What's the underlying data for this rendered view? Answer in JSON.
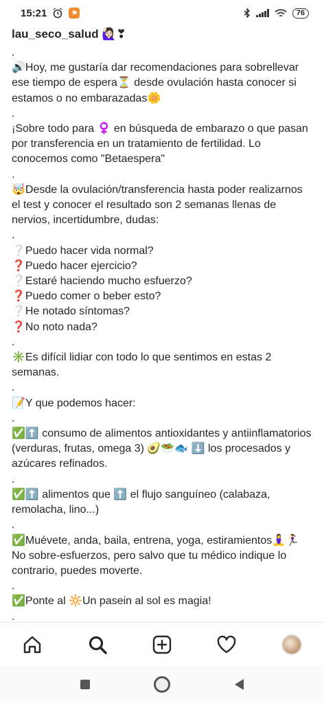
{
  "status_bar": {
    "time": "15:21",
    "battery": "76"
  },
  "post": {
    "username": "lau_seco_salud 🙋🏻‍♀️❣",
    "caption_blocks": [
      ".",
      "🔊Hoy, me gustaría dar recomendaciones para sobrellevar ese tiempo de espera⏳ desde ovulación hasta conocer si estamos o no embarazadas🌼",
      ".",
      "¡Sobre todo para ♀️ en búsqueda de embarazo o que pasan por transferencia en un tratamiento de fertilidad. Lo conocemos como \"Betaespera\"",
      ".",
      "🤯Desde la ovulación/transferencia hasta poder realizarnos el test y conocer el resultado son 2 semanas llenas de nervios, incertidumbre, dudas:",
      ".",
      "❔Puedo hacer vida normal?\n❓Puedo hacer ejercicio?\n❔Estaré haciendo mucho esfuerzo?\n❓Puedo comer o beber esto?\n❔He notado síntomas?\n❓No noto nada?",
      ".",
      "✳️Es difícil lidiar con todo lo que sentimos en estas 2 semanas.",
      ".",
      "📝Y que podemos hacer:",
      ".",
      "✅⬆️ consumo de alimentos antioxidantes y antiinflamatorios (verduras, frutas, omega 3) 🥑🥗🐟 ⬇️ los procesados y azúcares refinados.",
      ".",
      "✅⬆️ alimentos que ⬆️ el flujo sanguíneo (calabaza, remolacha, lino...)",
      ".",
      "✅Muévete, anda, baila, entrena, yoga, estiramientos🧘‍♀️🏃‍♀️ No sobre-esfuerzos, pero salvo que tu médico indique lo contrario, puedes moverte.",
      ".",
      "✅Ponte al 🔆Un pasein al sol es magia!",
      "."
    ]
  },
  "bottom_nav": {
    "items": [
      "home-icon",
      "search-icon",
      "new-post-icon",
      "activity-heart-icon",
      "profile-avatar"
    ]
  },
  "system_nav": [
    "recents-square-icon",
    "home-circle-icon",
    "back-triangle-icon"
  ],
  "colors": {
    "text": "#262626",
    "divider": "#e6e6e6",
    "badge": "#f08a2c"
  }
}
